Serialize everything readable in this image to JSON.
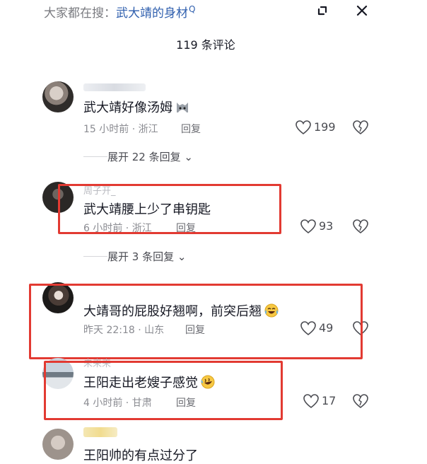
{
  "search": {
    "prefix": "大家都在搜：",
    "keyword": "武大靖的身材",
    "mark": "Q"
  },
  "header": {
    "comment_count": "119 条评论"
  },
  "comments": [
    {
      "text": "武大靖好像汤姆",
      "time": "15 小时前 · 浙江",
      "reply": "回复",
      "likes": "199",
      "emoji_icon": "cat-face"
    },
    {
      "username": "周子开_",
      "text": "武大靖腰上少了串钥匙",
      "time": "6 小时前 · 浙江",
      "reply": "回复",
      "likes": "93"
    },
    {
      "text": "大靖哥的屁股好翘啊，前突后翘",
      "time": "昨天 22:18 · 山东",
      "reply": "回复",
      "likes": "49",
      "emoji_icon": "tears-of-joy"
    },
    {
      "username": "未来来",
      "text": "王阳走出老嫂子感觉",
      "time": "4 小时前 · 甘肃",
      "reply": "回复",
      "likes": "17",
      "emoji_icon": "rolling-laugh"
    },
    {
      "text": "王阳帅的有点过分了"
    }
  ],
  "expanders": [
    {
      "label": "展开 22 条回复"
    },
    {
      "label": "展开 3 条回复"
    }
  ],
  "colors": {
    "highlight_box": "#e23a32",
    "keyword": "#2f5fae",
    "background": "#ffffff"
  }
}
